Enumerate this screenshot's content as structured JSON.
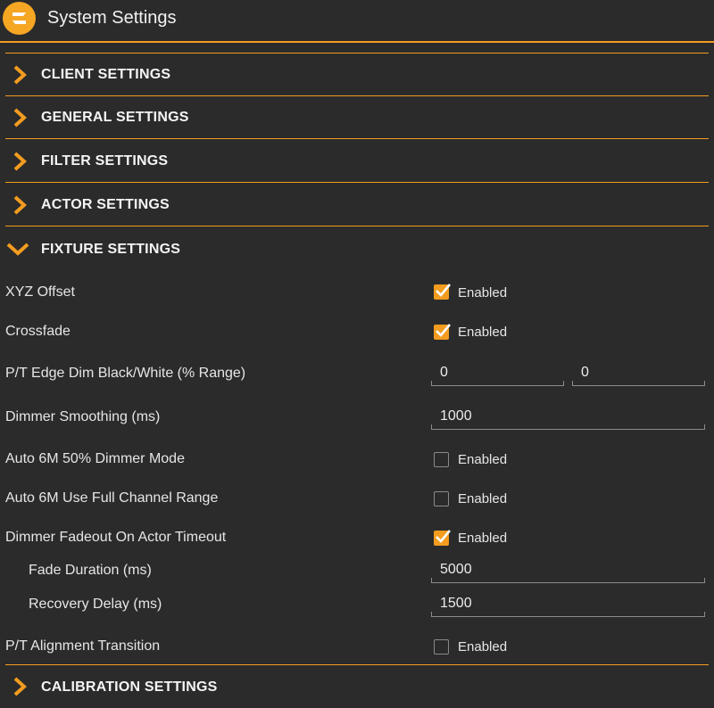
{
  "app": {
    "title": "System Settings",
    "logo_icon": "app-logo",
    "accent": "#f39c1f",
    "background": "#2b2b2b"
  },
  "sections": {
    "client": "CLIENT SETTINGS",
    "general": "GENERAL SETTINGS",
    "filter": "FILTER SETTINGS",
    "actor": "ACTOR SETTINGS",
    "fixture": "FIXTURE SETTINGS",
    "calibration": "CALIBRATION SETTINGS"
  },
  "fixture": {
    "enabled_label": "Enabled",
    "xyz_offset": {
      "label": "XYZ Offset",
      "checked": true
    },
    "crossfade": {
      "label": "Crossfade",
      "checked": true
    },
    "pt_edge_dim": {
      "label": "P/T Edge Dim Black/White (% Range)",
      "value_black": "0",
      "value_white": "0"
    },
    "dimmer_smoothing": {
      "label": "Dimmer Smoothing (ms)",
      "value": "1000"
    },
    "auto_6m_50": {
      "label": "Auto 6M 50% Dimmer Mode",
      "checked": false
    },
    "auto_6m_full": {
      "label": "Auto 6M Use Full Channel Range",
      "checked": false
    },
    "dimmer_fadeout": {
      "label": "Dimmer Fadeout On Actor Timeout",
      "checked": true
    },
    "fade_duration": {
      "label": "Fade Duration (ms)",
      "value": "5000"
    },
    "recovery_delay": {
      "label": "Recovery Delay (ms)",
      "value": "1500"
    },
    "pt_alignment": {
      "label": "P/T Alignment Transition",
      "checked": false
    }
  }
}
